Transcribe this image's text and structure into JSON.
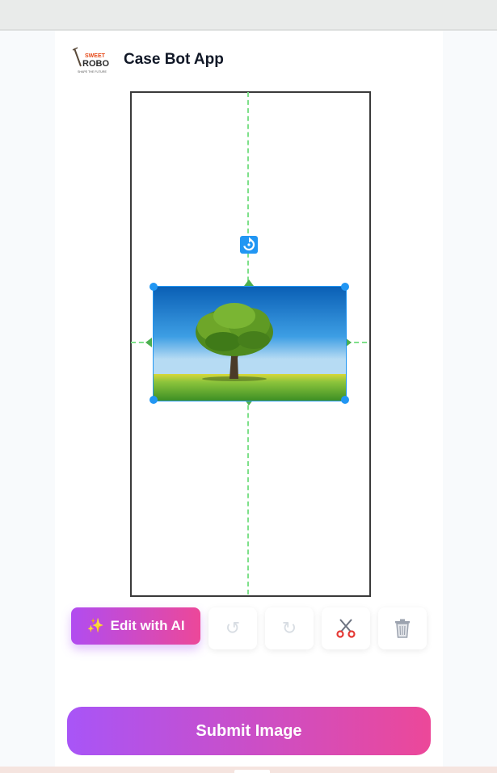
{
  "app": {
    "title": "Case Bot App",
    "logo": {
      "text_top": "SWEET",
      "text_main": "ROBO",
      "tagline": "SHAPE THE FUTURE"
    }
  },
  "editor": {
    "image_icon": "tree-landscape-photo",
    "guides_color": "#7ee08a",
    "selection_color": "#2196f3"
  },
  "toolbar": {
    "edit_ai_label": "Edit with AI",
    "edit_ai_icon": "sparkles-icon",
    "undo_icon": "undo-icon",
    "redo_icon": "redo-icon",
    "cut_icon": "scissors-icon",
    "delete_icon": "trash-icon"
  },
  "submit": {
    "label": "Submit Image"
  },
  "colors": {
    "gradient_start": "#a855f7",
    "gradient_end": "#ec4899"
  }
}
